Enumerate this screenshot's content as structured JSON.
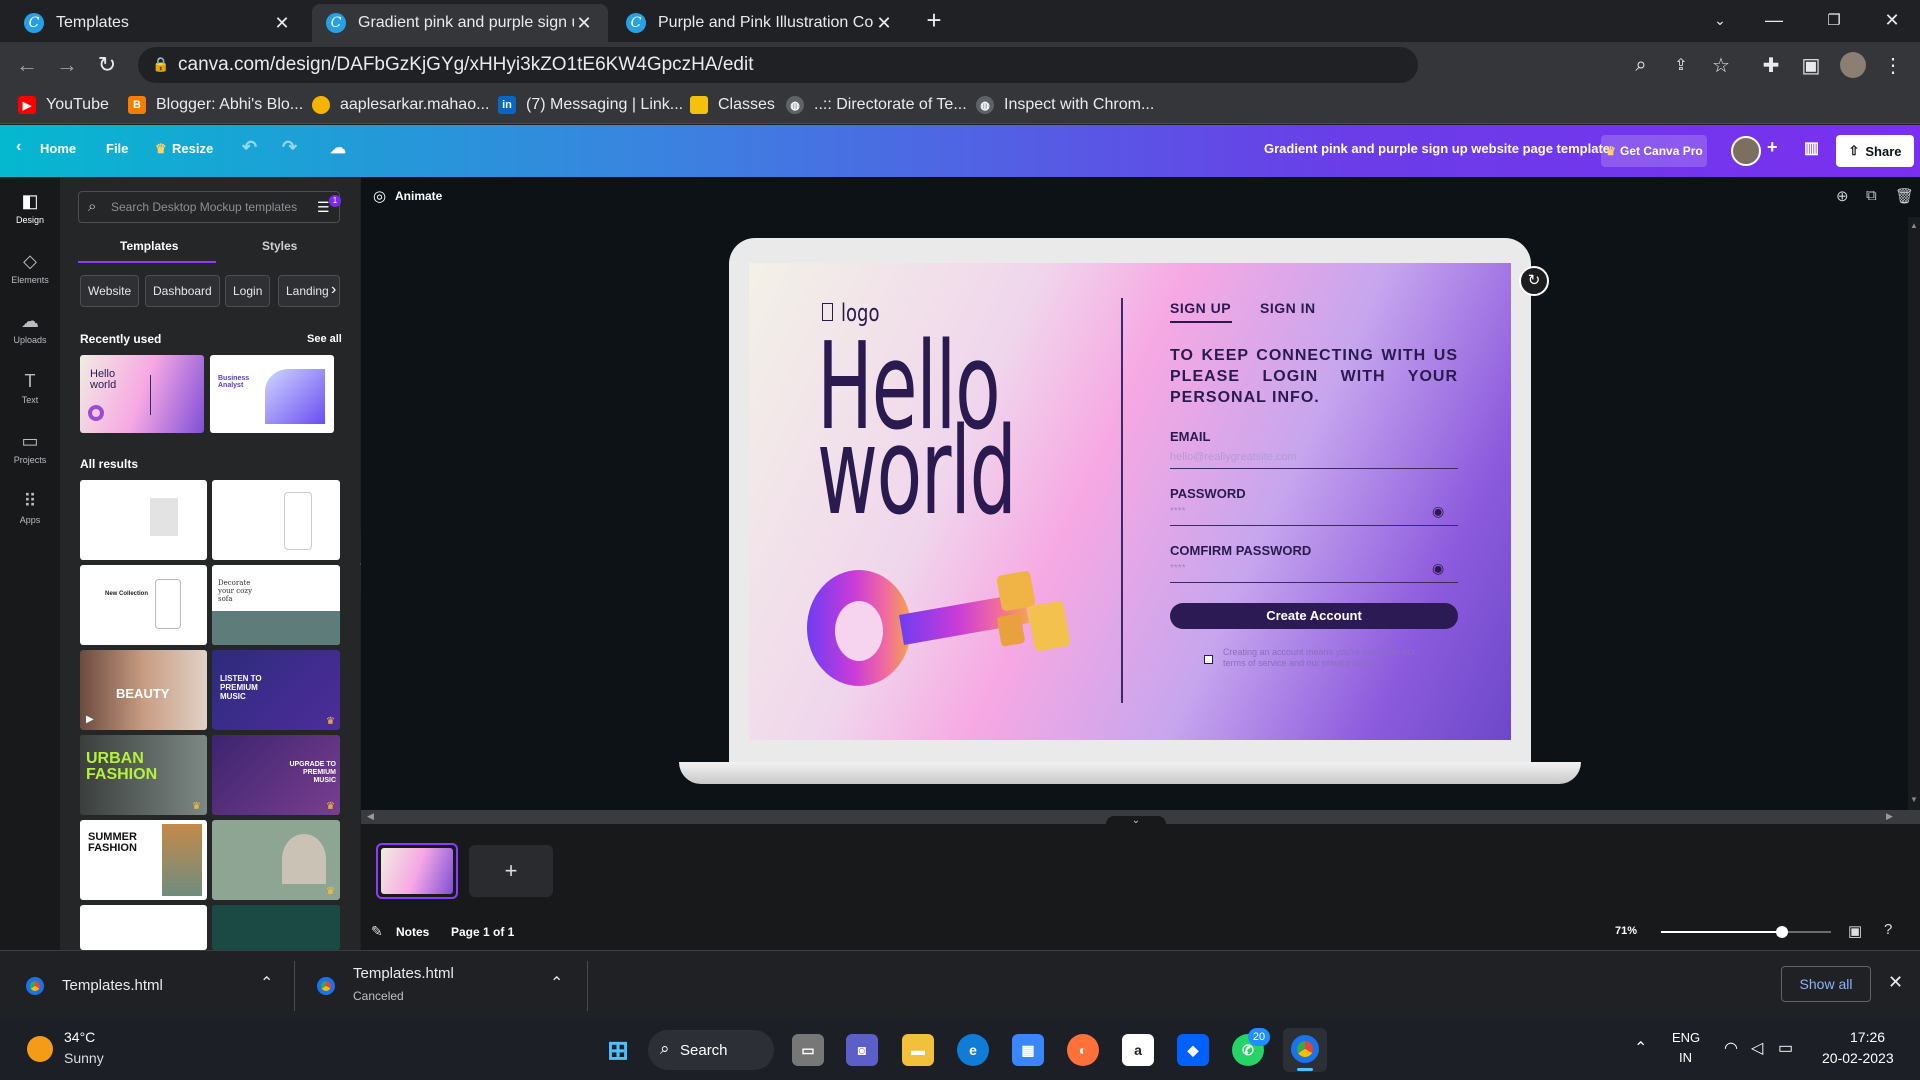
{
  "browser": {
    "tabs": [
      {
        "title": "Templates",
        "active": false
      },
      {
        "title": "Gradient pink and purple sign up",
        "active": true
      },
      {
        "title": "Purple and Pink Illustration Corp",
        "active": false
      }
    ],
    "url": "canva.com/design/DAFbGzKjGYg/xHHyi3kZO1tE6KW4GpczHA/edit",
    "bookmarks": [
      {
        "label": "YouTube",
        "icon": "youtube-icon"
      },
      {
        "label": "Blogger: Abhi's Blo...",
        "icon": "blogger-icon"
      },
      {
        "label": "aaplesarkar.mahao...",
        "icon": "aaplesarkar-icon"
      },
      {
        "label": "(7) Messaging | Link...",
        "icon": "linkedin-icon"
      },
      {
        "label": "Classes",
        "icon": "classroom-icon"
      },
      {
        "label": "..:: Directorate of Te...",
        "icon": "globe-icon"
      },
      {
        "label": "Inspect with Chrom...",
        "icon": "globe-icon"
      }
    ]
  },
  "canva_header": {
    "home": "Home",
    "file": "File",
    "resize": "Resize",
    "doc_title": "Gradient pink and purple sign up website page template",
    "get_pro": "Get Canva Pro",
    "share": "Share"
  },
  "rail": [
    {
      "label": "Design",
      "icon": "design-icon"
    },
    {
      "label": "Elements",
      "icon": "elements-icon"
    },
    {
      "label": "Uploads",
      "icon": "uploads-icon"
    },
    {
      "label": "Text",
      "icon": "text-icon"
    },
    {
      "label": "Projects",
      "icon": "projects-icon"
    },
    {
      "label": "Apps",
      "icon": "apps-icon"
    }
  ],
  "panel": {
    "search_placeholder": "Search Desktop Mockup templates",
    "filter_badge": "1",
    "tabs": [
      "Templates",
      "Styles"
    ],
    "chips": [
      "Website",
      "Dashboard",
      "Login",
      "Landing"
    ],
    "recently_used": "Recently used",
    "see_all": "See all",
    "all_results": "All results",
    "thumb_texts": {
      "r1": "Hello world",
      "r2": "Business Analyst",
      "beauty": "BEAUTY",
      "music": "LISTEN TO PREMIUM MUSIC",
      "urban": "URBAN FASHION",
      "upgrade": "UPGRADE TO PREMIUM MUSIC",
      "summer": "SUMMER FASHION",
      "decorate": "Decorate your cozy sofa",
      "collection": "New Collection"
    }
  },
  "canvas": {
    "animate": "Animate",
    "design": {
      "logo": "logo",
      "hello": "Hello",
      "world": "world",
      "tab_signup": "SIGN UP",
      "tab_signin": "SIGN IN",
      "heading": "TO KEEP CONNECTING WITH US PLEASE LOGIN WITH YOUR PERSONAL INFO.",
      "email_label": "EMAIL",
      "email_placeholder": "hello@reallygreatsite.com",
      "password_label": "PASSWORD",
      "password_value": "****",
      "confirm_label": "COMFIRM PASSWORD",
      "confirm_value": "****",
      "button": "Create Account",
      "terms": "Creating an account means you're okay with our terms of service and our privacy policy."
    }
  },
  "footer": {
    "notes": "Notes",
    "page": "Page 1 of 1",
    "zoom": "71%",
    "zoom_level": 0.71
  },
  "downloads": [
    {
      "name": "Templates.html",
      "status": ""
    },
    {
      "name": "Templates.html",
      "status": "Canceled"
    }
  ],
  "downloads_show_all": "Show all",
  "taskbar": {
    "temp": "34°C",
    "weather": "Sunny",
    "search": "Search",
    "lang": "ENG",
    "region": "IN",
    "time": "17:26",
    "date": "20-02-2023",
    "whatsapp_badge": "20"
  }
}
